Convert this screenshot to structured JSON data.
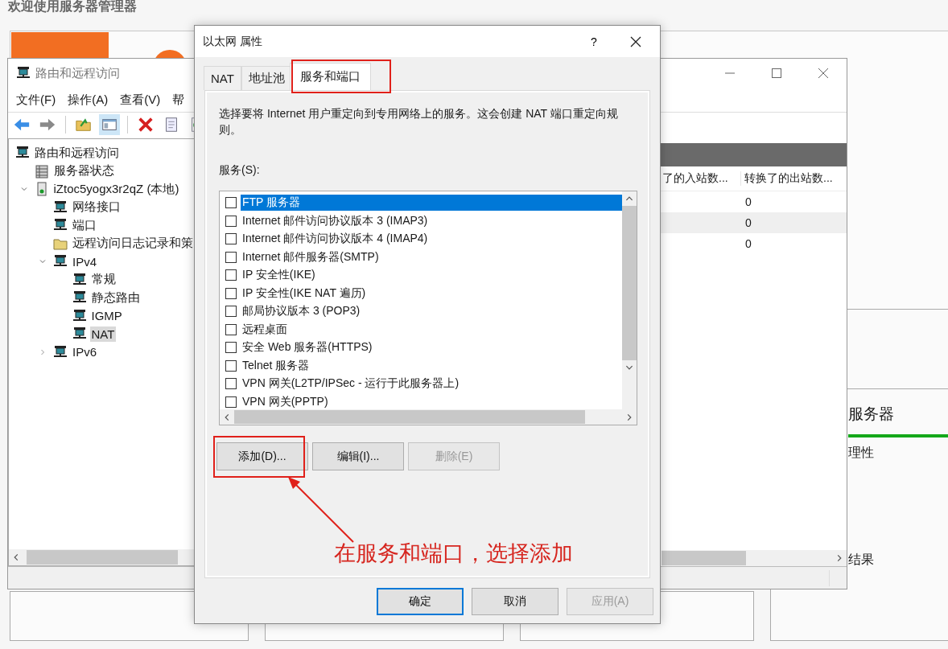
{
  "background": {
    "title": "欢迎使用服务器管理器",
    "tile_title": "服务器",
    "tile_texts": [
      "理性",
      "结果"
    ]
  },
  "routing_window": {
    "title": "路由和远程访问",
    "menu": [
      "文件(F)",
      "操作(A)",
      "查看(V)",
      "帮"
    ],
    "tree": [
      {
        "label": "路由和远程访问",
        "kind": "network",
        "selected": false,
        "children": [
          {
            "label": "服务器状态",
            "kind": "server",
            "selected": false
          },
          {
            "label": "iZtoc5yogx3r2qZ (本地)",
            "kind": "computer",
            "selected": false,
            "expanded": true,
            "children": [
              {
                "label": "网络接口",
                "kind": "network",
                "selected": false
              },
              {
                "label": "端口",
                "kind": "network",
                "selected": false
              },
              {
                "label": "远程访问日志记录和策",
                "kind": "folder",
                "selected": false
              },
              {
                "label": "IPv4",
                "kind": "network",
                "selected": false,
                "expanded": true,
                "children": [
                  {
                    "label": "常规",
                    "kind": "network",
                    "selected": false
                  },
                  {
                    "label": "静态路由",
                    "kind": "network",
                    "selected": false
                  },
                  {
                    "label": "IGMP",
                    "kind": "network",
                    "selected": false
                  },
                  {
                    "label": "NAT",
                    "kind": "network",
                    "selected": true
                  }
                ]
              },
              {
                "label": "IPv6",
                "kind": "network",
                "selected": false,
                "expanded": false
              }
            ]
          }
        ]
      }
    ],
    "table": {
      "columns": [
        "了的入站数...",
        "转换了的出站数..."
      ],
      "rows": [
        {
          "column_2": "0",
          "selected": false
        },
        {
          "column_2": "0",
          "selected": true
        },
        {
          "column_2": "0",
          "selected": false
        }
      ]
    }
  },
  "dialog": {
    "title": "以太网 属性",
    "help": "?",
    "tabs": [
      {
        "label": "NAT",
        "selected": false
      },
      {
        "label": "地址池",
        "selected": false
      },
      {
        "label": "服务和端口",
        "selected": true
      }
    ],
    "description": "选择要将 Internet 用户重定向到专用网络上的服务。这会创建 NAT 端口重定向规则。",
    "services_label": "服务(S):",
    "services": [
      {
        "label": "FTP 服务器",
        "checked": false,
        "selected": true
      },
      {
        "label": "Internet 邮件访问协议版本 3 (IMAP3)",
        "checked": false,
        "selected": false
      },
      {
        "label": "Internet 邮件访问协议版本 4 (IMAP4)",
        "checked": false,
        "selected": false
      },
      {
        "label": "Internet 邮件服务器(SMTP)",
        "checked": false,
        "selected": false
      },
      {
        "label": "IP 安全性(IKE)",
        "checked": false,
        "selected": false
      },
      {
        "label": "IP 安全性(IKE NAT 遍历)",
        "checked": false,
        "selected": false
      },
      {
        "label": "邮局协议版本 3 (POP3)",
        "checked": false,
        "selected": false
      },
      {
        "label": "远程桌面",
        "checked": false,
        "selected": false
      },
      {
        "label": "安全 Web 服务器(HTTPS)",
        "checked": false,
        "selected": false
      },
      {
        "label": "Telnet 服务器",
        "checked": false,
        "selected": false
      },
      {
        "label": "VPN 网关(L2TP/IPSec - 运行于此服务器上)",
        "checked": false,
        "selected": false
      },
      {
        "label": "VPN 网关(PPTP)",
        "checked": false,
        "selected": false
      }
    ],
    "list_buttons": [
      {
        "label": "添加(D)...",
        "disabled": false
      },
      {
        "label": "编辑(I)...",
        "disabled": false
      },
      {
        "label": "删除(E)",
        "disabled": true
      }
    ],
    "footer_buttons": [
      {
        "label": "确定",
        "kind": "default",
        "disabled": false
      },
      {
        "label": "取消",
        "kind": "normal",
        "disabled": false
      },
      {
        "label": "应用(A)",
        "kind": "normal",
        "disabled": true
      }
    ]
  },
  "annotation": {
    "text": "在服务和端口，选择添加"
  }
}
